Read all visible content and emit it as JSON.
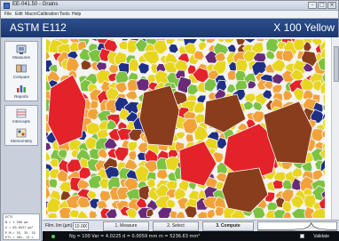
{
  "window": {
    "title": "EE-041.50 - Grains"
  },
  "menu": {
    "items": [
      "File",
      "Edit",
      "Macro",
      "Calibration",
      "Tools",
      "Help"
    ]
  },
  "header": {
    "left": "ASTM E112",
    "right": "X 100 Yellow"
  },
  "sidebar": {
    "items": [
      {
        "label": "Measures",
        "icon": "measure-icon"
      },
      {
        "label": "Compare",
        "icon": "compare-icon"
      },
      {
        "label": "Reports",
        "icon": "reports-icon"
      },
      {
        "label": "Intercepts",
        "icon": "intercepts-icon"
      },
      {
        "label": "Stereometry",
        "icon": "stereometry-icon"
      }
    ],
    "info": [
      "ECTS",
      "N = 1 586 µm",
      "S = 89.0537 µm²",
      "P.M.= 55, 35, 35",
      "ET% = 30%, 13 %"
    ]
  },
  "toolbar": {
    "film_label": "Film. lim (µm)",
    "film_value": "10.000",
    "measure_label": "1. Measure",
    "select_label": "2. Select",
    "compute_label": "3. Compute"
  },
  "status": {
    "text": "Ng = 100  Var = 4.0225  d = 0.0059 mm  m = 5236.63 mm²",
    "validate_label": "Validate"
  },
  "colors": {
    "header": "#1b376e",
    "grain_palette": [
      "#e8d51e",
      "#f2a23a",
      "#7cc243",
      "#e4222a",
      "#8a3d1c",
      "#1e2f86",
      "#6a2a7a"
    ]
  }
}
